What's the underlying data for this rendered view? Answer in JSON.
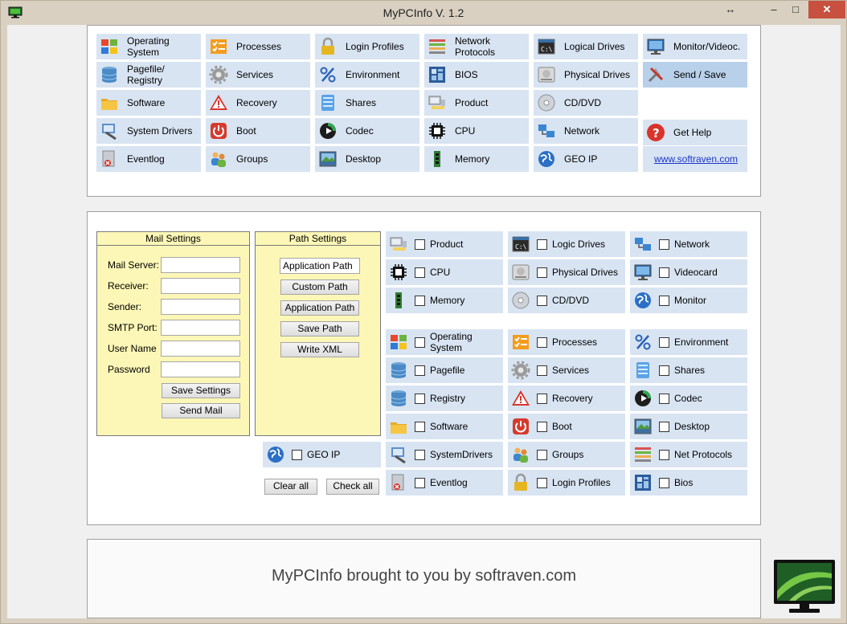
{
  "window": {
    "title": "MyPCInfo V. 1.2",
    "btn_restore": "↔",
    "btn_min": "–",
    "btn_max": "□",
    "btn_close": "✕"
  },
  "modules": [
    {
      "label": "Operating System",
      "icon": "windows-icon"
    },
    {
      "label": "Processes",
      "icon": "processes-icon"
    },
    {
      "label": "Login Profiles",
      "icon": "lock-icon"
    },
    {
      "label": "Network Protocols",
      "icon": "network-protocols-icon"
    },
    {
      "label": "Logical Drives",
      "icon": "cmd-icon"
    },
    {
      "label": "Monitor/Videoc.",
      "icon": "monitor-icon"
    },
    {
      "label": "Pagefile/\nRegistry",
      "icon": "database-icon"
    },
    {
      "label": "Services",
      "icon": "gear-icon"
    },
    {
      "label": "Environment",
      "icon": "percent-icon"
    },
    {
      "label": "BIOS",
      "icon": "motherboard-icon"
    },
    {
      "label": "Physical Drives",
      "icon": "hard-drive-icon"
    },
    {
      "label": "Send / Save",
      "icon": "tools-icon"
    },
    {
      "label": "Software",
      "icon": "folder-icon"
    },
    {
      "label": "Recovery",
      "icon": "warning-icon"
    },
    {
      "label": "Shares",
      "icon": "shares-icon"
    },
    {
      "label": "Product",
      "icon": "computer-icon"
    },
    {
      "label": "CD/DVD",
      "icon": "cd-icon"
    },
    {
      "label": "",
      "icon": ""
    },
    {
      "label": "System Drivers",
      "icon": "drivers-icon"
    },
    {
      "label": "Boot",
      "icon": "power-icon"
    },
    {
      "label": "Codec",
      "icon": "codec-icon"
    },
    {
      "label": "CPU",
      "icon": "cpu-icon"
    },
    {
      "label": "Network",
      "icon": "network-icon"
    },
    {
      "label": "Get Help",
      "icon": "help-icon"
    },
    {
      "label": "Eventlog",
      "icon": "eventlog-icon"
    },
    {
      "label": "Groups",
      "icon": "groups-icon"
    },
    {
      "label": "Desktop",
      "icon": "desktop-icon"
    },
    {
      "label": "Memory",
      "icon": "memory-icon"
    },
    {
      "label": "GEO IP",
      "icon": "globe-icon"
    },
    {
      "label": "www.softraven.com",
      "icon": ""
    }
  ],
  "mail": {
    "title": "Mail Settings",
    "fields": [
      {
        "label": "Mail Server:",
        "value": ""
      },
      {
        "label": "Receiver:",
        "value": ""
      },
      {
        "label": "Sender:",
        "value": ""
      },
      {
        "label": "SMTP Port:",
        "value": ""
      },
      {
        "label": "User Name",
        "value": ""
      },
      {
        "label": "Password",
        "value": ""
      }
    ],
    "save_label": "Save Settings",
    "send_label": "Send Mail"
  },
  "path": {
    "title": "Path Settings",
    "value": "Application Path",
    "buttons": [
      "Custom Path",
      "Application Path",
      "Save Path",
      "Write XML"
    ]
  },
  "geoip": {
    "label": "GEO IP",
    "icon": "globe-icon"
  },
  "actions": {
    "clear_label": "Clear all",
    "check_label": "Check all"
  },
  "checks": [
    {
      "label": "Product",
      "icon": "computer-icon"
    },
    {
      "label": "Logic Drives",
      "icon": "cmd-icon"
    },
    {
      "label": "Network",
      "icon": "network-icon"
    },
    {
      "label": "CPU",
      "icon": "cpu-icon"
    },
    {
      "label": "Physical Drives",
      "icon": "hard-drive-icon"
    },
    {
      "label": "Videocard",
      "icon": "monitor-icon"
    },
    {
      "label": "Memory",
      "icon": "memory-icon"
    },
    {
      "label": "CD/DVD",
      "icon": "cd-icon"
    },
    {
      "label": "Monitor",
      "icon": "globe-icon"
    },
    {
      "label": "Operating System",
      "icon": "windows-icon"
    },
    {
      "label": "Processes",
      "icon": "processes-icon"
    },
    {
      "label": "Environment",
      "icon": "percent-icon"
    },
    {
      "label": "Pagefile",
      "icon": "database-icon"
    },
    {
      "label": "Services",
      "icon": "gear-icon"
    },
    {
      "label": "Shares",
      "icon": "shares-icon"
    },
    {
      "label": "Registry",
      "icon": "database-icon"
    },
    {
      "label": "Recovery",
      "icon": "warning-icon"
    },
    {
      "label": "Codec",
      "icon": "codec-icon"
    },
    {
      "label": "Software",
      "icon": "folder-icon"
    },
    {
      "label": "Boot",
      "icon": "power-icon"
    },
    {
      "label": "Desktop",
      "icon": "desktop-icon"
    },
    {
      "label": "SystemDrivers",
      "icon": "drivers-icon"
    },
    {
      "label": "Groups",
      "icon": "groups-icon"
    },
    {
      "label": "Net Protocols",
      "icon": "network-protocols-icon"
    },
    {
      "label": "Eventlog",
      "icon": "eventlog-icon"
    },
    {
      "label": "Login Profiles",
      "icon": "lock-icon"
    },
    {
      "label": "Bios",
      "icon": "motherboard-icon"
    }
  ],
  "footer": {
    "text": "MyPCInfo brought to you by softraven.com"
  },
  "colors": {
    "button_bg": "#d8e4f2",
    "active_bg": "#b8d0ea",
    "settings_bg": "#fcf7b6",
    "close_red": "#c7503f",
    "link": "#1a35c9"
  }
}
